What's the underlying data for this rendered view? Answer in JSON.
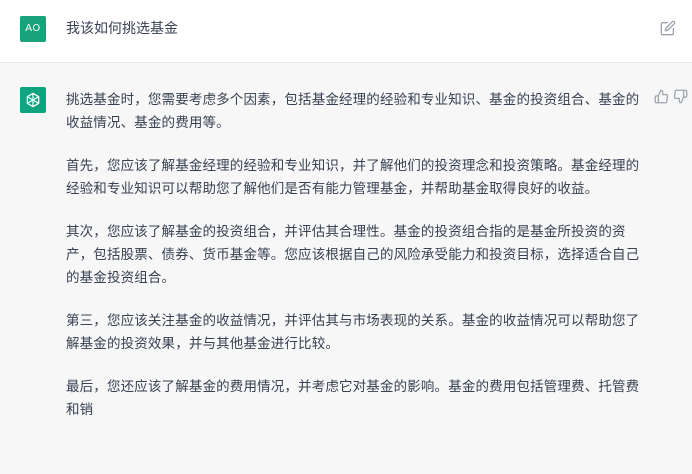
{
  "user": {
    "avatar_initials": "AO",
    "message": "我该如何挑选基金"
  },
  "icons": {
    "edit": "edit-icon",
    "thumbs_up": "thumbs-up-icon",
    "thumbs_down": "thumbs-down-icon",
    "assistant_logo": "openai-logo-icon"
  },
  "assistant": {
    "paragraphs": [
      "挑选基金时，您需要考虑多个因素，包括基金经理的经验和专业知识、基金的投资组合、基金的收益情况、基金的费用等。",
      "首先，您应该了解基金经理的经验和专业知识，并了解他们的投资理念和投资策略。基金经理的经验和专业知识可以帮助您了解他们是否有能力管理基金，并帮助基金取得良好的收益。",
      "其次，您应该了解基金的投资组合，并评估其合理性。基金的投资组合指的是基金所投资的资产，包括股票、债券、货币基金等。您应该根据自己的风险承受能力和投资目标，选择适合自己的基金投资组合。",
      "第三，您应该关注基金的收益情况，并评估其与市场表现的关系。基金的收益情况可以帮助您了解基金的投资效果，并与其他基金进行比较。",
      "最后，您还应该了解基金的费用情况，并考虑它对基金的影响。基金的费用包括管理费、托管费和销"
    ]
  },
  "colors": {
    "brand_green": "#10a37f",
    "user_avatar": "#1aa37a",
    "assistant_bg": "#f7f7f8",
    "text": "#374151"
  }
}
